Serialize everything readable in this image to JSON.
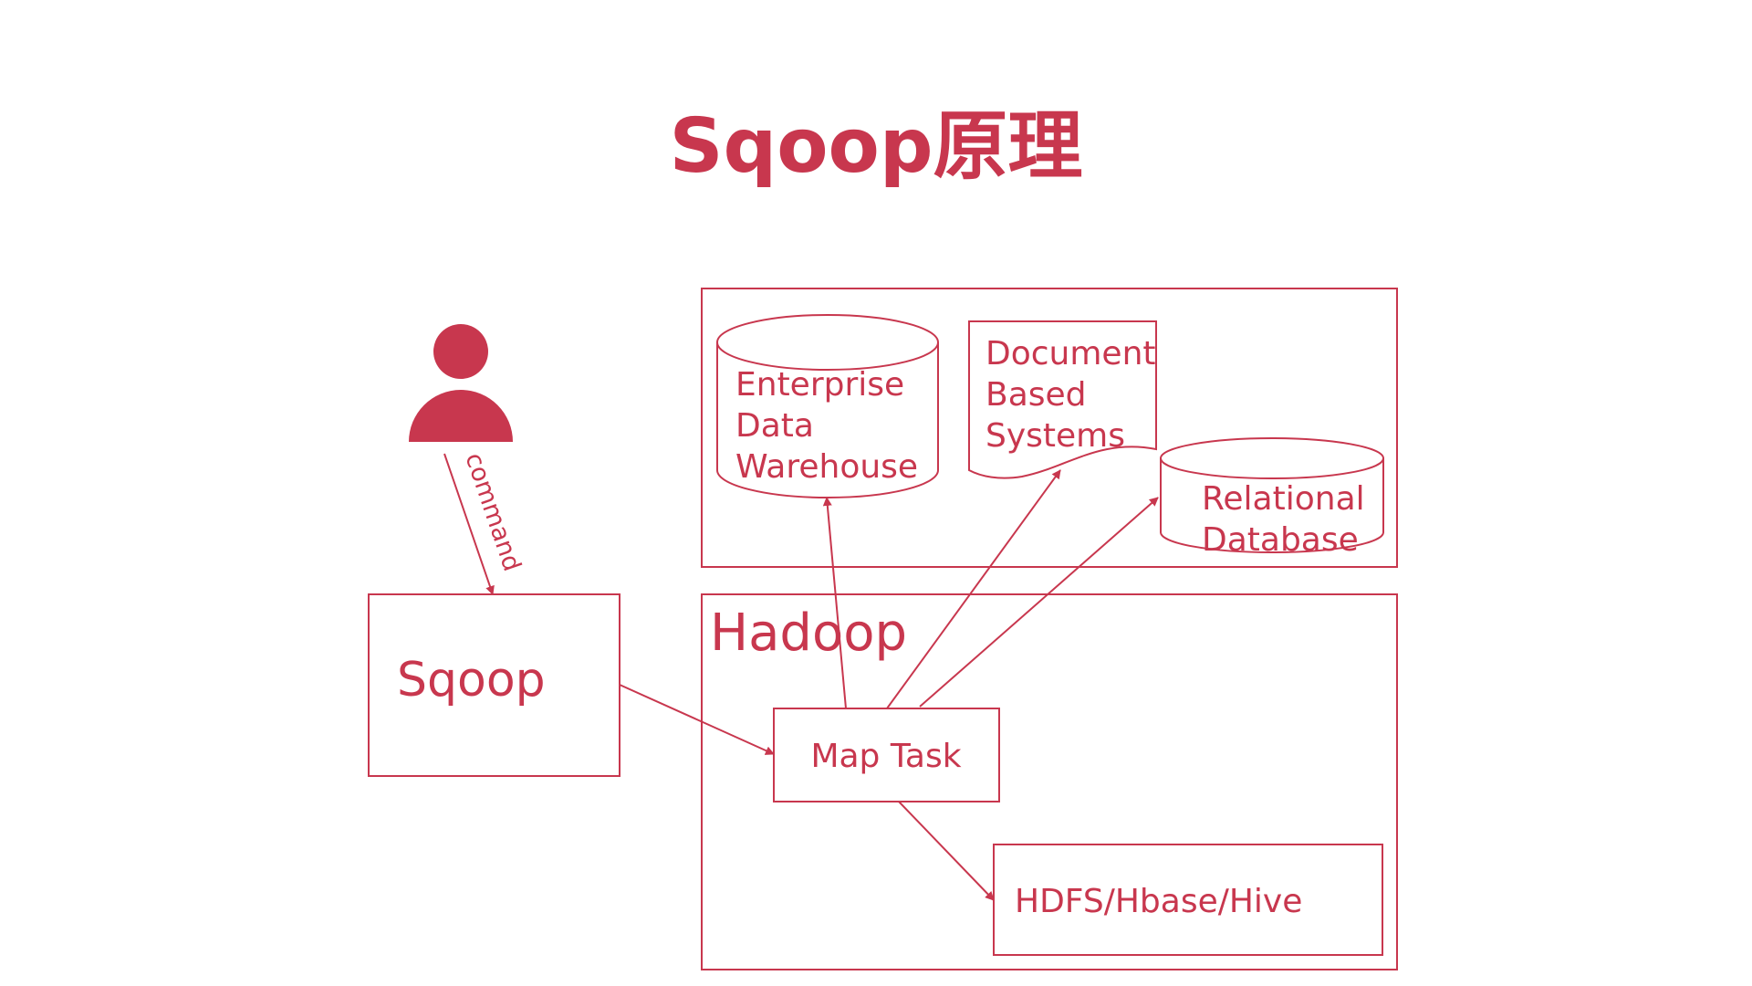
{
  "title": "Sqoop原理",
  "colors": {
    "accent": "#c8374e",
    "background": "#ffffff"
  },
  "user": {
    "icon": "person-icon",
    "edge_label": "command"
  },
  "sqoop_box": {
    "label": "Sqoop"
  },
  "hadoop_box": {
    "label": "Hadoop"
  },
  "map_task": {
    "label": "Map Task"
  },
  "hdfs_box": {
    "label": "HDFS/Hbase/Hive"
  },
  "targets": {
    "warehouse": {
      "lines": [
        "Enterprise",
        "Data",
        "Warehouse"
      ]
    },
    "document": {
      "lines": [
        "Document",
        "Based",
        "Systems"
      ]
    },
    "relational": {
      "lines": [
        "Relational",
        "Database"
      ]
    }
  }
}
